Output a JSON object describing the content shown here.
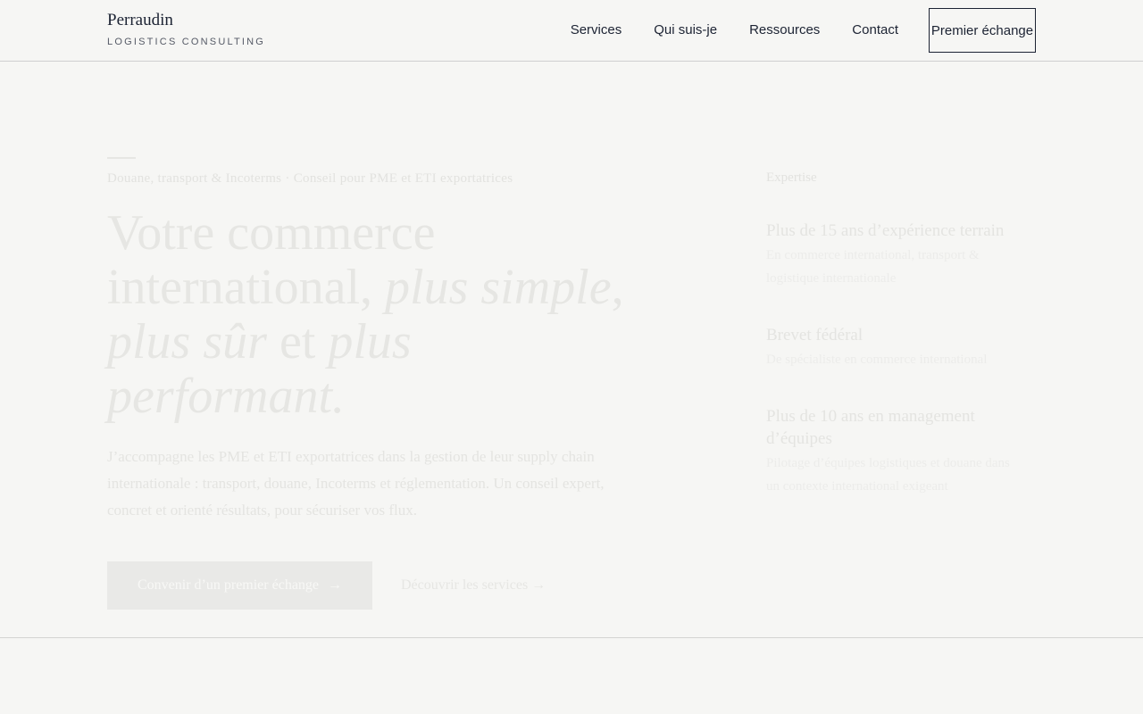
{
  "header": {
    "brand_name": "Perraudin",
    "brand_sub": "LOGISTICS CONSULTING",
    "nav": [
      "Services",
      "Qui suis-je",
      "Ressources",
      "Contact"
    ],
    "cta": "Premier échange"
  },
  "hero": {
    "eyebrow": "Douane, transport & Incoterms · Conseil pour PME et ETI exportatrices",
    "title_line1": "Votre commerce",
    "title_line2_normal": "international, ",
    "title_line2_italic": "plus simple",
    "title_line2_end": ",",
    "title_line3_italic1": "plus sûr",
    "title_line3_normal": " et ",
    "title_line3_italic2": "plus performant.",
    "lead": "J’accompagne les PME et ETI exportatrices dans la gestion de leur supply chain internationale : transport, douane, Incoterms et réglementation. Un conseil expert, concret et orienté résultats, pour sécuriser vos flux.",
    "primary_button": "Convenir d’un premier échange",
    "primary_arrow": "→",
    "secondary_button": "Découvrir les services",
    "secondary_arrow": "→"
  },
  "aside": {
    "label": "Expertise",
    "stats": [
      {
        "title": "Plus de 15 ans d’expérience terrain",
        "text": "En commerce international, transport & logistique internationale"
      },
      {
        "title": "Brevet fédéral",
        "text": "De spécialiste en commerce international"
      },
      {
        "title": "Plus de 10 ans en management d’équipes",
        "text": "Pilotage d’équipes logistiques et douane dans un contexte international exigeant"
      }
    ]
  }
}
